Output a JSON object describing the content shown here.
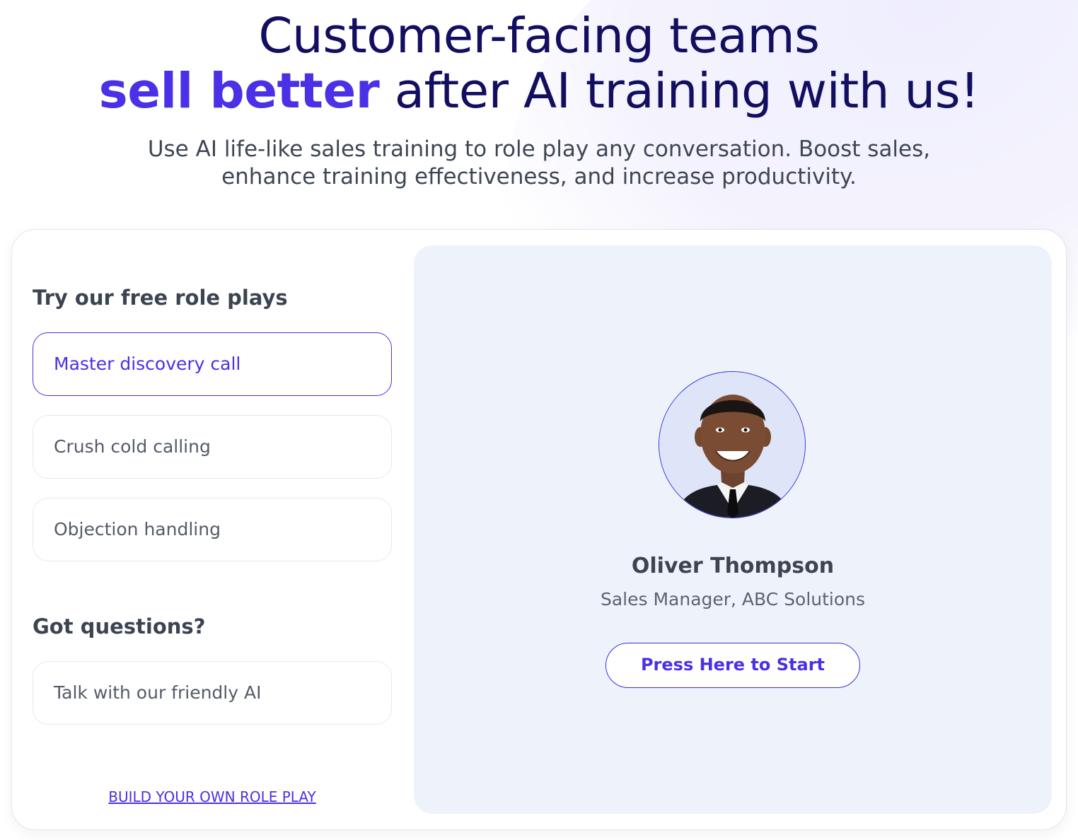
{
  "hero": {
    "line1": "Customer-facing teams",
    "line2_accent": "sell better",
    "line2_rest": " after AI training with us!",
    "subtitle": "Use AI life-like sales training to role play any conversation. Boost sales, enhance training effectiveness, and increase productivity."
  },
  "role_plays": {
    "heading": "Try our free role plays",
    "items": [
      {
        "label": "Master discovery call",
        "selected": true
      },
      {
        "label": "Crush cold calling",
        "selected": false
      },
      {
        "label": "Objection handling",
        "selected": false
      }
    ]
  },
  "questions": {
    "heading": "Got questions?",
    "item": {
      "label": "Talk with our friendly AI"
    }
  },
  "build_link": "BUILD YOUR OWN ROLE PLAY",
  "persona": {
    "name": "Oliver Thompson",
    "role": "Sales Manager, ABC Solutions",
    "start_label": "Press Here to Start"
  },
  "colors": {
    "accent": "#4a30e6",
    "heading_navy": "#120f60",
    "preview_bg": "#eef3fb"
  }
}
